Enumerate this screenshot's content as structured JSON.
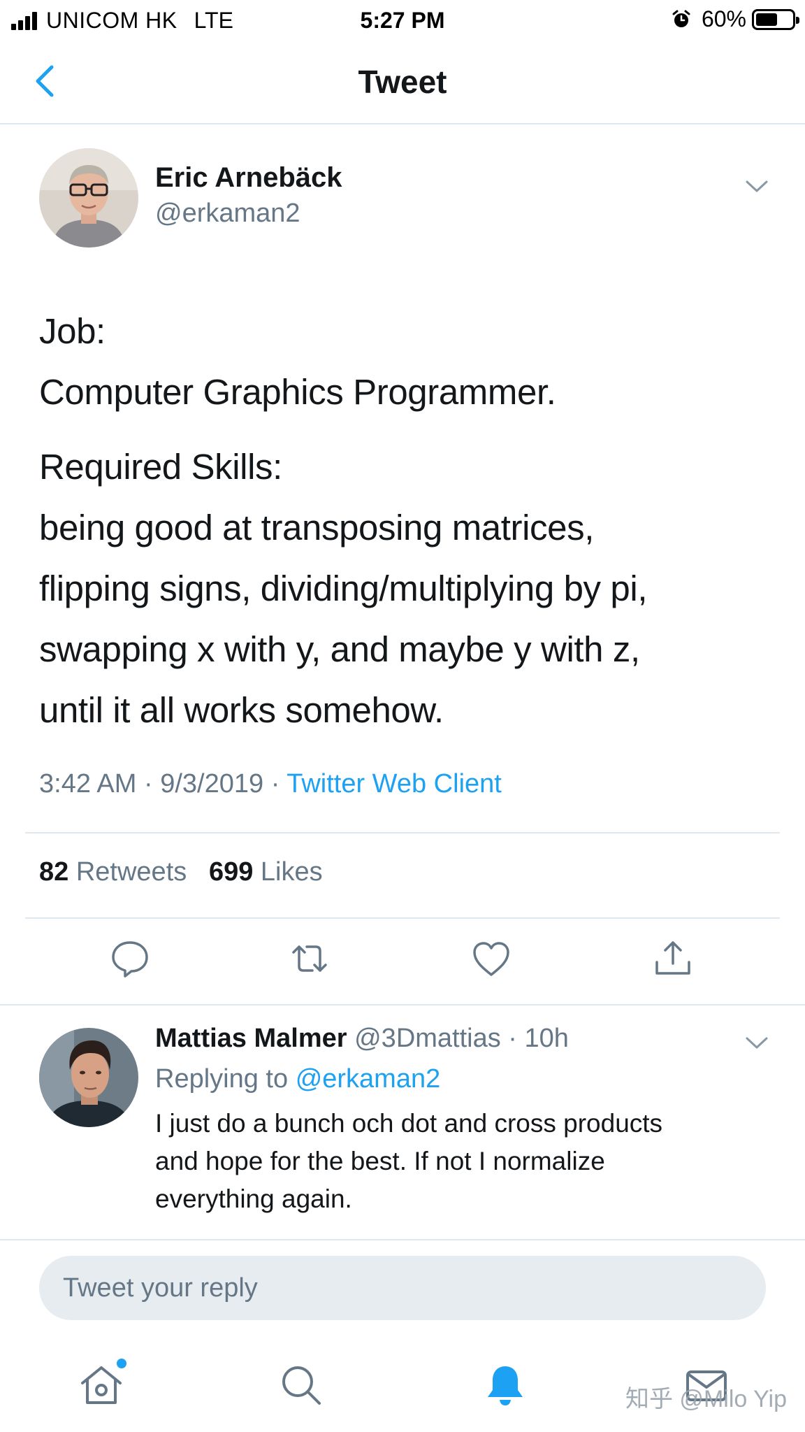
{
  "status_bar": {
    "carrier": "UNICOM HK",
    "network": "LTE",
    "time": "5:27 PM",
    "battery_percent": "60%",
    "battery_level": 0.6,
    "icons": [
      "signal-icon",
      "alarm-icon",
      "battery-icon"
    ]
  },
  "nav": {
    "title": "Tweet",
    "back_icon": "chevron-left-icon"
  },
  "tweet": {
    "author_name": "Eric Arnebäck",
    "author_handle": "@erkaman2",
    "lines": [
      "Job:",
      "Computer Graphics Programmer.",
      "Required Skills:",
      "being good at transposing matrices,",
      "flipping signs, dividing/multiplying by pi,",
      "swapping x with y, and maybe y with z,",
      "until it all works somehow."
    ],
    "time": "3:42 AM",
    "date": "9/3/2019",
    "source": "Twitter Web Client",
    "retweet_count": "82",
    "retweet_label": "Retweets",
    "like_count": "699",
    "like_label": "Likes",
    "actions": [
      "reply-icon",
      "retweet-icon",
      "like-icon",
      "share-icon"
    ]
  },
  "reply": {
    "name": "Mattias Malmer",
    "handle": "@3Dmattias",
    "time": "10h",
    "replying_label": "Replying to",
    "replying_to": "@erkaman2",
    "lines": [
      "I just do a bunch och dot and cross products",
      "and hope for the best. If not I normalize",
      "everything again."
    ]
  },
  "compose": {
    "placeholder": "Tweet your reply"
  },
  "tab_bar": {
    "tabs": [
      "home-icon",
      "search-icon",
      "notifications-icon",
      "messages-icon"
    ],
    "watermark": "知乎 @Milo Yip"
  },
  "colors": {
    "accent": "#1da1f2",
    "secondary_text": "#657786",
    "divider": "#e1e8ed"
  }
}
